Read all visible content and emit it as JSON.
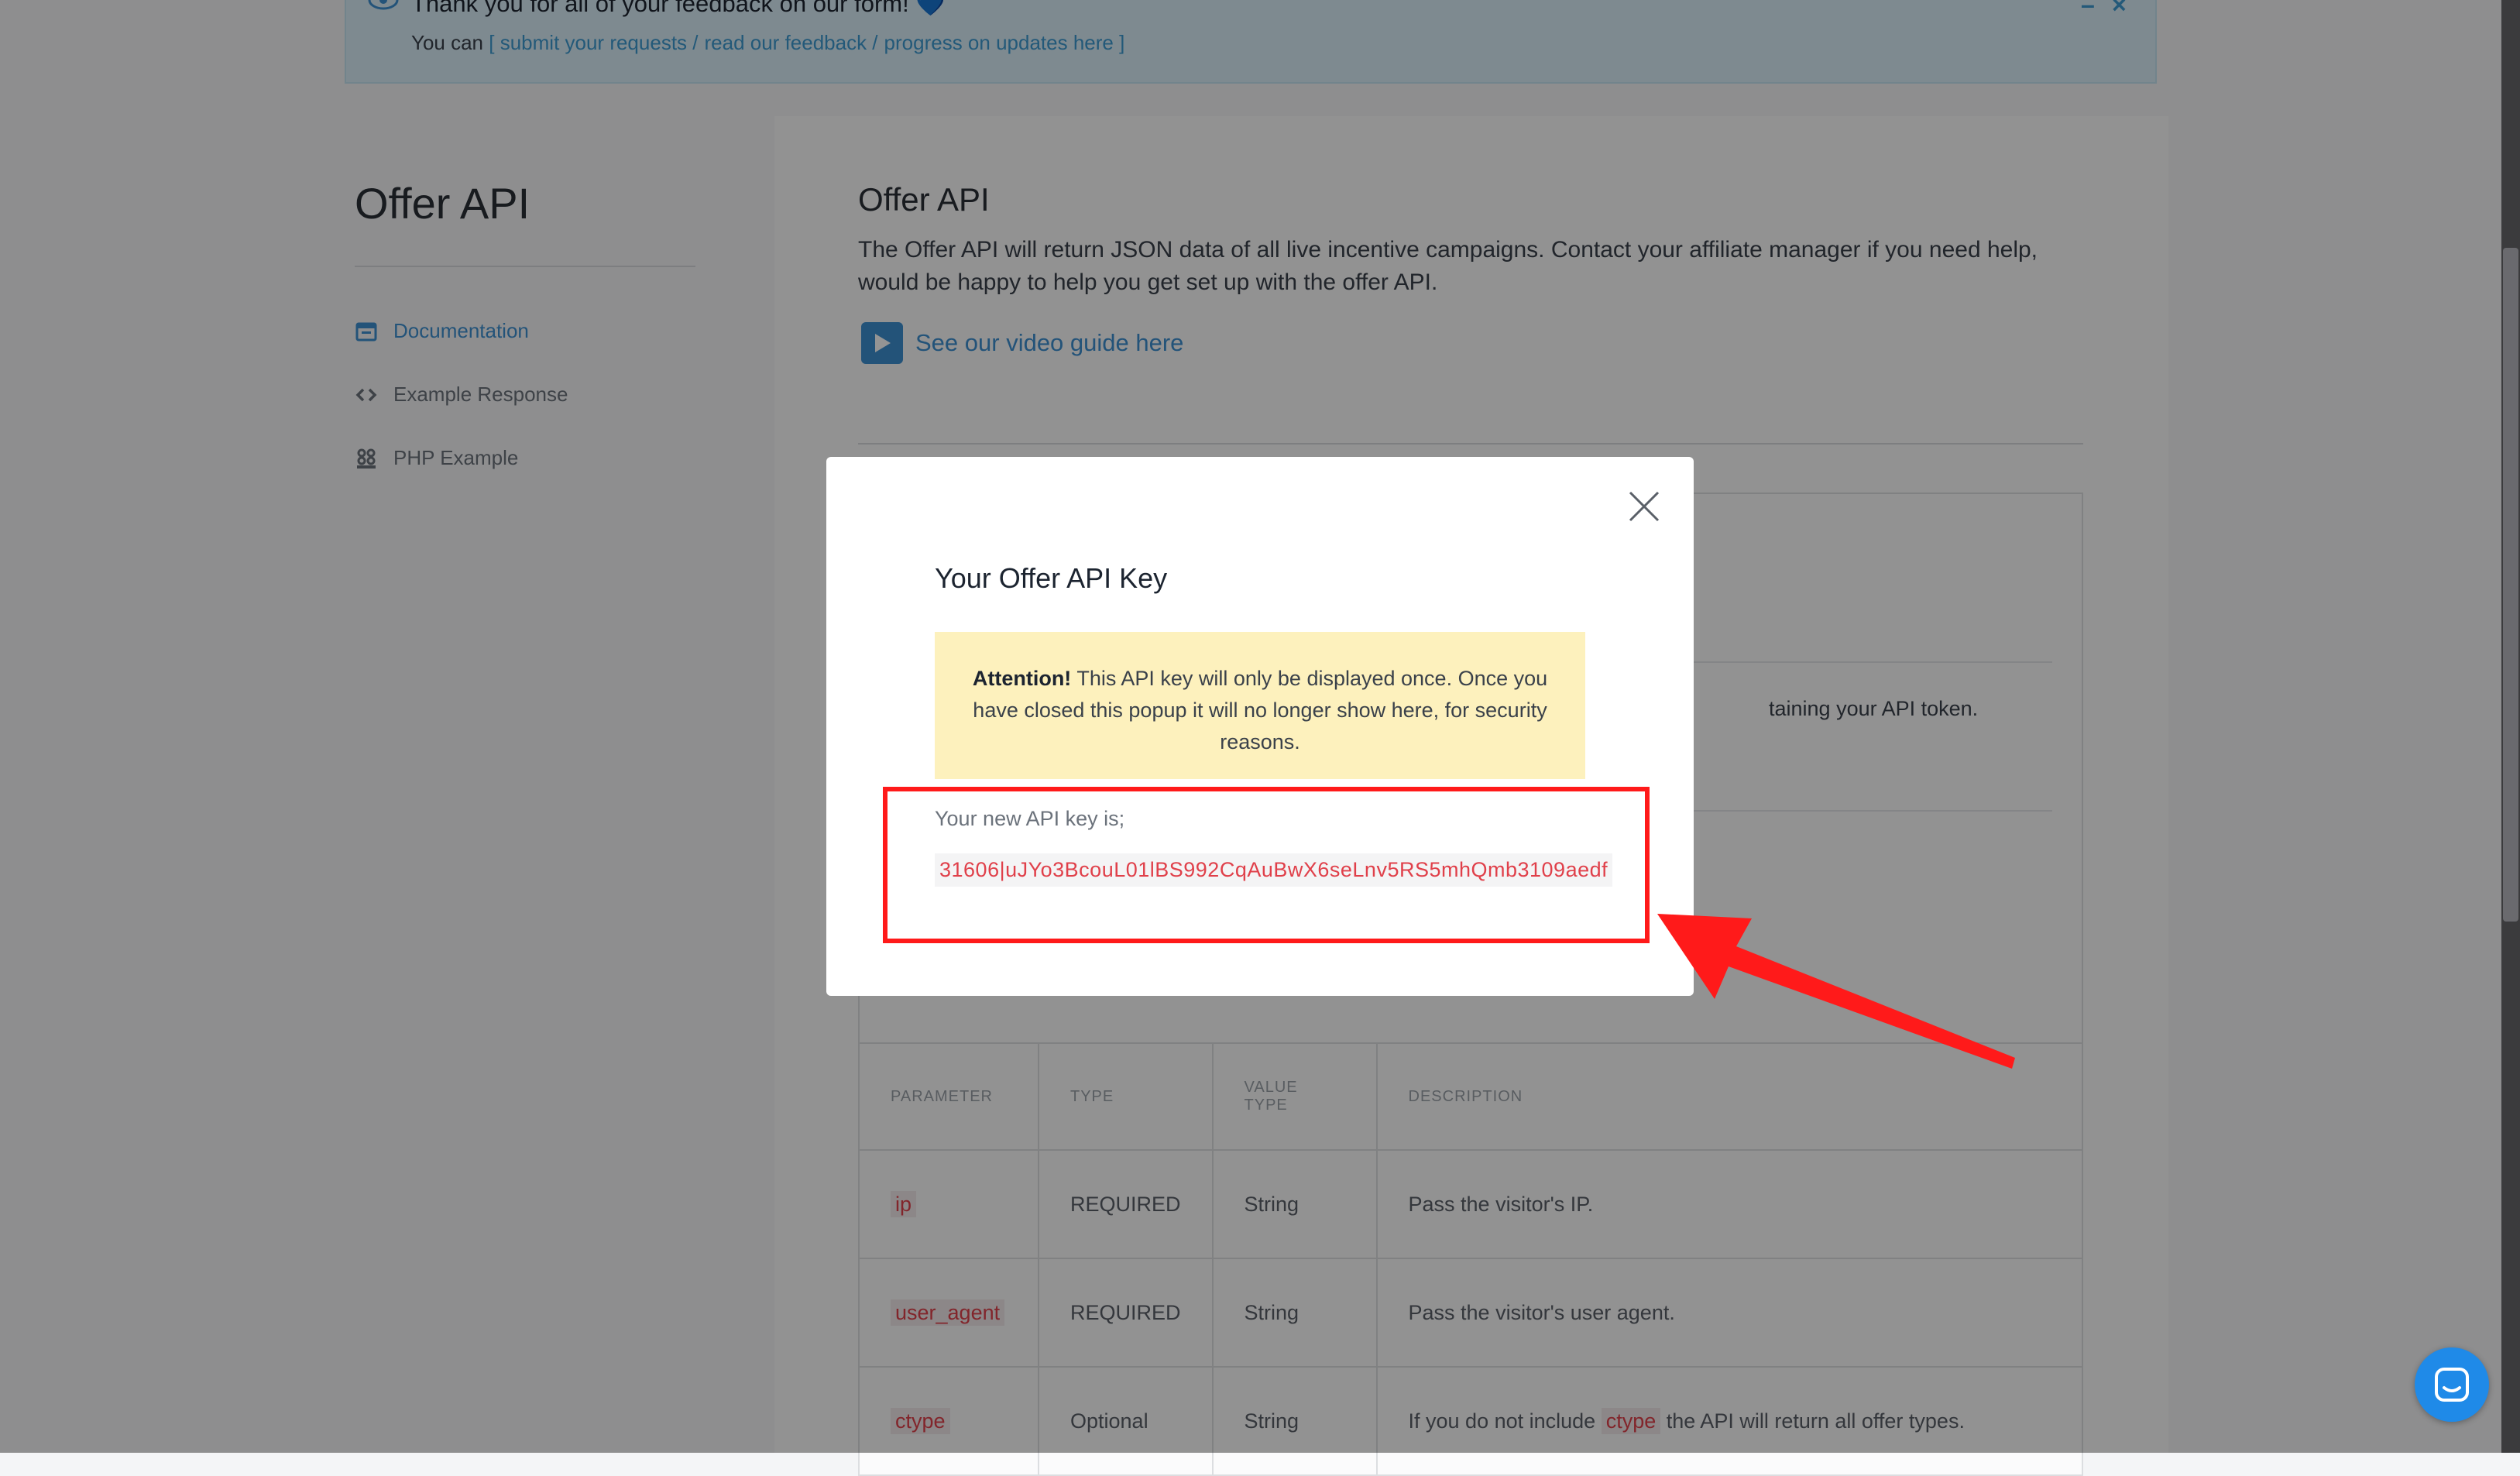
{
  "banner": {
    "title": "Thank you for all of your feedback on our form!",
    "heart": "💙",
    "prefix": "You can",
    "link_submit": "[ submit your requests /",
    "link_feedback": "read our feedback /",
    "link_progress": "progress on updates here ]",
    "minimize": "–",
    "close": "×"
  },
  "sidebar": {
    "title": "Offer API",
    "items": [
      {
        "label": "Documentation",
        "icon": "calendar-icon"
      },
      {
        "label": "Example Response",
        "icon": "code-icon"
      },
      {
        "label": "PHP Example",
        "icon": "php-icon"
      }
    ]
  },
  "main": {
    "title": "Offer API",
    "description": "The Offer API will return JSON data of all live incentive campaigns. Contact your affiliate manager if you need help, would be happy to help you get set up with the offer API.",
    "video_link": "See our video guide here",
    "partial_text": "taining your API token."
  },
  "table": {
    "headers": [
      "PARAMETER",
      "TYPE",
      "VALUE TYPE",
      "DESCRIPTION"
    ],
    "rows": [
      {
        "param": "ip",
        "type": "REQUIRED",
        "value_type": "String",
        "description": "Pass the visitor's IP."
      },
      {
        "param": "user_agent",
        "type": "REQUIRED",
        "value_type": "String",
        "description": "Pass the visitor's user agent."
      },
      {
        "param": "ctype",
        "type": "Optional",
        "value_type": "String",
        "desc_before": "If you do not include",
        "desc_code": "ctype",
        "desc_after": "the API will return all offer types."
      }
    ]
  },
  "modal": {
    "title": "Your Offer API Key",
    "attention_label": "Attention!",
    "attention_text": "This API key will only be displayed once. Once you have closed this popup it will no longer show here, for security reasons.",
    "key_label": "Your new API key is;",
    "key_value": "31606|uJYo3BcouL01lBS992CqAuBwX6seLnv5RS5mhQmb3109aedf"
  },
  "colors": {
    "accent": "#3d8fd0",
    "annotation": "#ff1a1a",
    "attention_bg": "#fdf1bd",
    "key_text": "#e0404a",
    "chat_button": "#1f8ae8"
  }
}
